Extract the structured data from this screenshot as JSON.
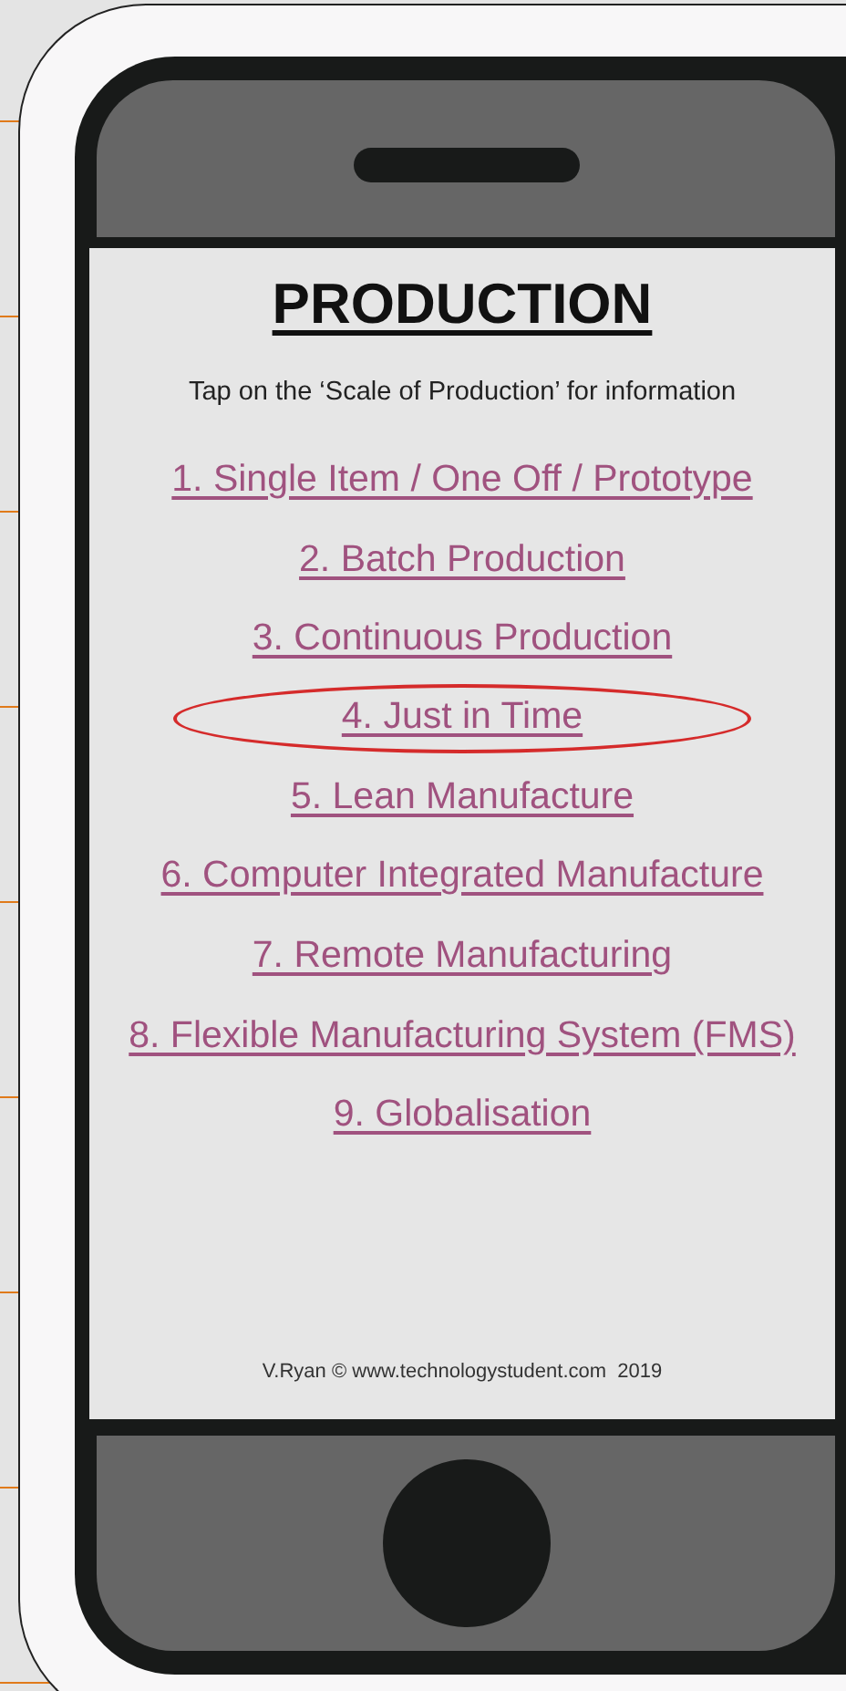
{
  "title": "PRODUCTION",
  "instruction": "Tap on the ‘Scale of Production’ for information",
  "items": [
    {
      "label": "1. Single Item / One Off / Prototype",
      "circled": false
    },
    {
      "label": "2. Batch Production",
      "circled": false
    },
    {
      "label": "3. Continuous Production",
      "circled": false
    },
    {
      "label": "4. Just in Time",
      "circled": true
    },
    {
      "label": "5. Lean Manufacture",
      "circled": false
    },
    {
      "label": "6. Computer Integrated Manufacture",
      "circled": false
    },
    {
      "label": "7. Remote Manufacturing",
      "circled": false
    },
    {
      "label": "8. Flexible Manufacturing System (FMS)",
      "circled": false
    },
    {
      "label": "9. Globalisation",
      "circled": false
    }
  ],
  "footer": "V.Ryan © www.technologystudent.com  2019"
}
